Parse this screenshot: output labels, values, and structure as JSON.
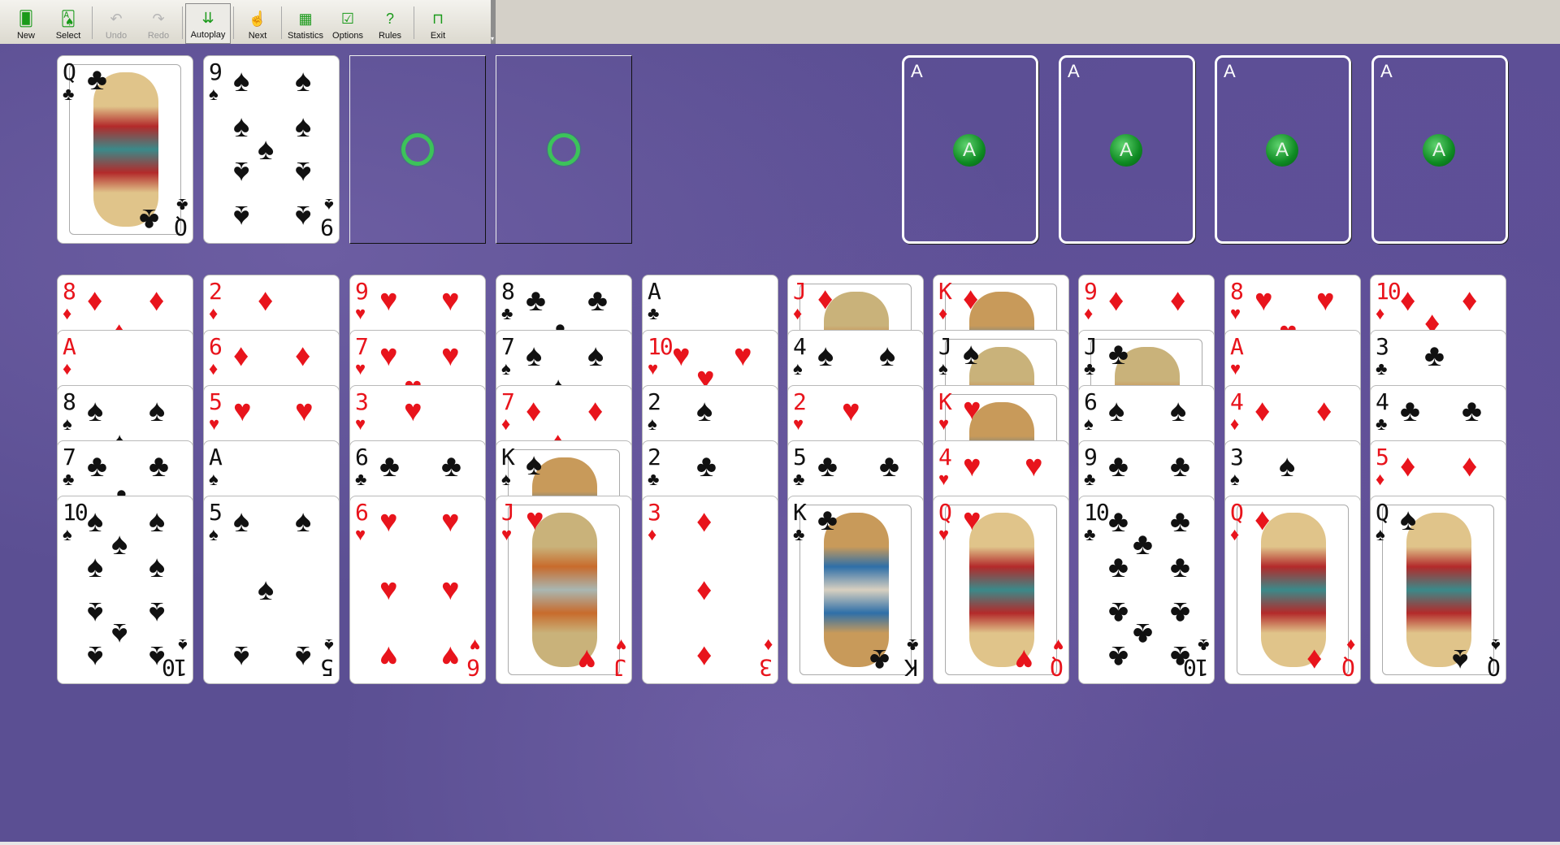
{
  "toolbar": {
    "buttons": [
      {
        "label": "New",
        "icon": "new-game-icon",
        "glyph": "🂠",
        "enabled": true
      },
      {
        "label": "Select",
        "icon": "select-game-icon",
        "glyph": "🂡",
        "enabled": true
      },
      {
        "label": "Undo",
        "icon": "undo-icon",
        "glyph": "↶",
        "enabled": false
      },
      {
        "label": "Redo",
        "icon": "redo-icon",
        "glyph": "↷",
        "enabled": false
      },
      {
        "label": "Autoplay",
        "icon": "autoplay-icon",
        "glyph": "⇊",
        "enabled": true,
        "active": true
      },
      {
        "label": "Next",
        "icon": "next-move-icon",
        "glyph": "☝",
        "enabled": true
      },
      {
        "label": "Statistics",
        "icon": "statistics-icon",
        "glyph": "▦",
        "enabled": true
      },
      {
        "label": "Options",
        "icon": "options-icon",
        "glyph": "☑",
        "enabled": true
      },
      {
        "label": "Rules",
        "icon": "rules-icon",
        "glyph": "?",
        "enabled": true
      },
      {
        "label": "Exit",
        "icon": "exit-icon",
        "glyph": "⊓",
        "enabled": true
      }
    ],
    "overflow_glyph": "▾"
  },
  "colors": {
    "felt": "#5b4f93",
    "red_suit": "#e8141c",
    "black_suit": "#111111",
    "ring": "#3cc35a"
  },
  "freecells": [
    {
      "rank": "Q",
      "suit": "♣",
      "color": "black",
      "face": true
    },
    {
      "rank": "9",
      "suit": "♠",
      "color": "black",
      "face": false
    },
    null,
    null
  ],
  "foundations": [
    {
      "label": "A",
      "badge": "A"
    },
    {
      "label": "A",
      "badge": "A"
    },
    {
      "label": "A",
      "badge": "A"
    },
    {
      "label": "A",
      "badge": "A"
    }
  ],
  "tableau": [
    [
      {
        "rank": "8",
        "suit": "♦"
      },
      {
        "rank": "A",
        "suit": "♦"
      },
      {
        "rank": "8",
        "suit": "♠"
      },
      {
        "rank": "7",
        "suit": "♣"
      },
      {
        "rank": "10",
        "suit": "♠"
      }
    ],
    [
      {
        "rank": "2",
        "suit": "♦"
      },
      {
        "rank": "6",
        "suit": "♦"
      },
      {
        "rank": "5",
        "suit": "♥"
      },
      {
        "rank": "A",
        "suit": "♠"
      },
      {
        "rank": "5",
        "suit": "♠"
      }
    ],
    [
      {
        "rank": "9",
        "suit": "♥"
      },
      {
        "rank": "7",
        "suit": "♥"
      },
      {
        "rank": "3",
        "suit": "♥"
      },
      {
        "rank": "6",
        "suit": "♣"
      },
      {
        "rank": "6",
        "suit": "♥"
      }
    ],
    [
      {
        "rank": "8",
        "suit": "♣"
      },
      {
        "rank": "7",
        "suit": "♠"
      },
      {
        "rank": "7",
        "suit": "♦"
      },
      {
        "rank": "K",
        "suit": "♠"
      },
      {
        "rank": "J",
        "suit": "♥"
      }
    ],
    [
      {
        "rank": "A",
        "suit": "♣"
      },
      {
        "rank": "10",
        "suit": "♥"
      },
      {
        "rank": "2",
        "suit": "♠"
      },
      {
        "rank": "2",
        "suit": "♣"
      },
      {
        "rank": "3",
        "suit": "♦"
      }
    ],
    [
      {
        "rank": "J",
        "suit": "♦"
      },
      {
        "rank": "4",
        "suit": "♠"
      },
      {
        "rank": "2",
        "suit": "♥"
      },
      {
        "rank": "5",
        "suit": "♣"
      },
      {
        "rank": "K",
        "suit": "♣"
      }
    ],
    [
      {
        "rank": "K",
        "suit": "♦"
      },
      {
        "rank": "J",
        "suit": "♠"
      },
      {
        "rank": "K",
        "suit": "♥"
      },
      {
        "rank": "4",
        "suit": "♥"
      },
      {
        "rank": "Q",
        "suit": "♥"
      }
    ],
    [
      {
        "rank": "9",
        "suit": "♦"
      },
      {
        "rank": "J",
        "suit": "♣"
      },
      {
        "rank": "6",
        "suit": "♠"
      },
      {
        "rank": "9",
        "suit": "♣"
      },
      {
        "rank": "10",
        "suit": "♣"
      }
    ],
    [
      {
        "rank": "8",
        "suit": "♥"
      },
      {
        "rank": "A",
        "suit": "♥"
      },
      {
        "rank": "4",
        "suit": "♦"
      },
      {
        "rank": "3",
        "suit": "♠"
      },
      {
        "rank": "Q",
        "suit": "♦"
      }
    ],
    [
      {
        "rank": "10",
        "suit": "♦"
      },
      {
        "rank": "3",
        "suit": "♣"
      },
      {
        "rank": "4",
        "suit": "♣"
      },
      {
        "rank": "5",
        "suit": "♦"
      },
      {
        "rank": "Q",
        "suit": "♠"
      }
    ]
  ]
}
